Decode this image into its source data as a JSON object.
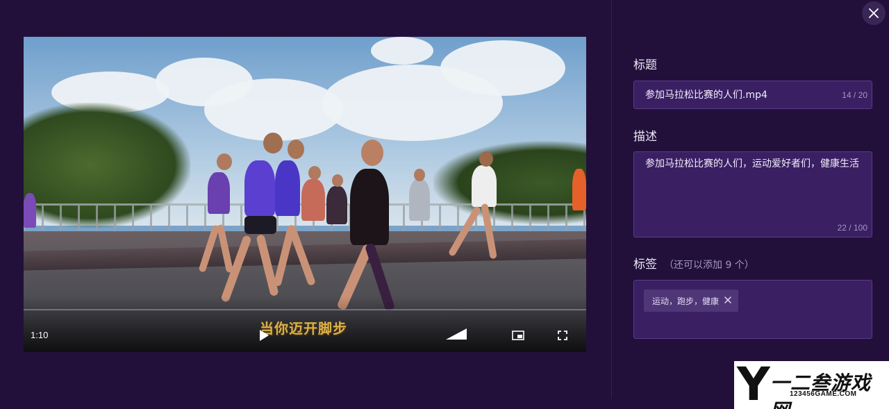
{
  "video": {
    "current_time": "1:10",
    "subtitle": "当你迈开脚步",
    "icons": [
      "play-icon",
      "volume-icon",
      "picture-in-picture-icon",
      "fullscreen-icon"
    ]
  },
  "form": {
    "title": {
      "label": "标题",
      "value": "参加马拉松比赛的人们.mp4",
      "count": "14 / 20"
    },
    "description": {
      "label": "描述",
      "value": "参加马拉松比赛的人们，运动爱好者们，健康生活",
      "count": "22 / 100"
    },
    "tags": {
      "label": "标签",
      "hint": "（还可以添加 9 个）",
      "items": [
        {
          "text": "运动，跑步，健康"
        }
      ]
    }
  },
  "watermark": {
    "logo_letter": "Y",
    "name": "一二叁游戏网",
    "url": "123456GAME.COM"
  },
  "colors": {
    "background": "#22103b",
    "field_bg": "#3a1f63",
    "field_border": "#5a3b8a",
    "tag_bg": "#4f3676"
  }
}
